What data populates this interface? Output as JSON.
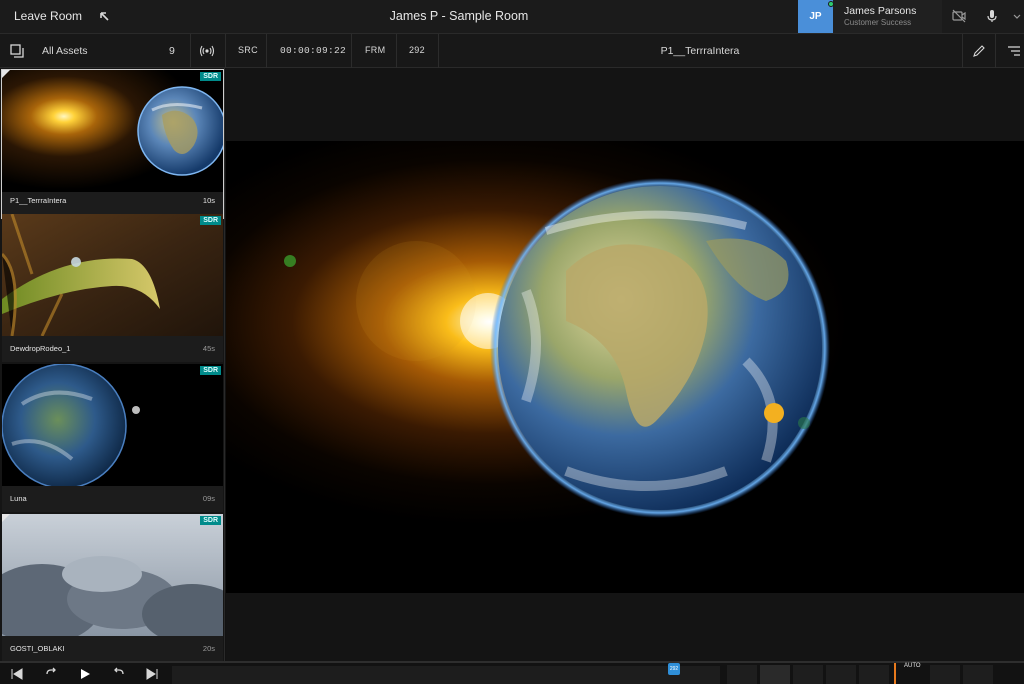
{
  "header": {
    "leave_label": "Leave Room",
    "room_title": "James P - Sample Room",
    "user": {
      "initials": "JP",
      "name": "James Parsons",
      "role": "Customer Success"
    },
    "icons": [
      "collapse-arrow-icon",
      "camera-off-icon",
      "microphone-icon",
      "chevron-down-icon"
    ]
  },
  "toolbar": {
    "all_assets_label": "All Assets",
    "asset_count": "9",
    "src_label": "SRC",
    "timecode": "00:00:09:22",
    "frm_label": "FRM",
    "frame_number": "292",
    "current_asset": "P1__TerrraIntera"
  },
  "assets": [
    {
      "name": "P1__TerrraIntera",
      "duration": "10s",
      "badge": "SDR",
      "selected": true
    },
    {
      "name": "DewdropRodeo_1",
      "duration": "45s",
      "badge": "SDR",
      "selected": false
    },
    {
      "name": "Luna",
      "duration": "09s",
      "badge": "SDR",
      "selected": false
    },
    {
      "name": "GOSTI_OBLAKI",
      "duration": "20s",
      "badge": "SDR",
      "selected": false
    }
  ],
  "transport": {
    "auto_label": "AUTO",
    "playhead_label": "292"
  },
  "colors": {
    "accent": "#4a8fd9",
    "badge": "#008b8b",
    "marker": "#e87a1d",
    "online": "#2ecc71"
  }
}
